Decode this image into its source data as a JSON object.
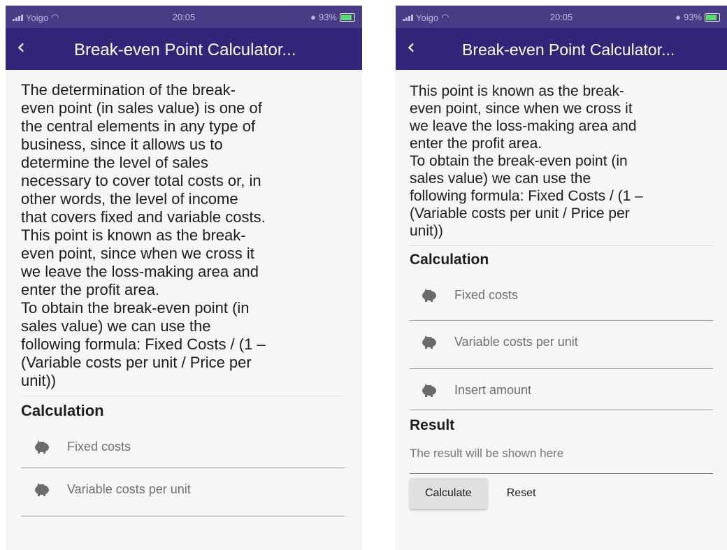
{
  "status": {
    "carrier": "Yoigo",
    "time": "20:05",
    "battery": "93%"
  },
  "appbar": {
    "title": "Break-even Point Calculator...",
    "back_icon": "chevron-left-icon"
  },
  "left": {
    "description": "The determination of the break-\neven point (in sales value) is one of\nthe central elements in any type of\nbusiness, since it allows us to\ndetermine the level of sales\nnecessary to cover total costs or, in\nother words, the level of income\nthat covers fixed and variable costs.\nThis point is known as the break-\neven point, since when we cross it\nwe leave the loss-making area and\nenter the profit area.\nTo obtain the break-even point (in\nsales value) we can use the\nfollowing formula: Fixed Costs / (1 –\n(Variable costs per unit / Price per\nunit))",
    "calc_title": "Calculation",
    "fields": [
      "Fixed costs",
      "Variable costs per unit"
    ]
  },
  "right": {
    "description": "This point is known as the break-\neven point, since when we cross it\nwe leave the loss-making area and\nenter the profit area.\nTo obtain the break-even point (in\nsales value) we can use the\nfollowing formula: Fixed Costs / (1 –\n(Variable costs per unit / Price per\nunit))",
    "calc_title": "Calculation",
    "fields": [
      "Fixed costs",
      "Variable costs per unit",
      "Insert amount"
    ],
    "result_title": "Result",
    "result_text": "The result will be shown here",
    "calculate_label": "Calculate",
    "reset_label": "Reset"
  },
  "colors": {
    "appbar": "#33267a",
    "statusbar": "#3a2d7e",
    "background": "#f6f6f6",
    "icon": "#6b6b6b"
  },
  "icons": {
    "field_icon": "piggy-bank-icon"
  }
}
